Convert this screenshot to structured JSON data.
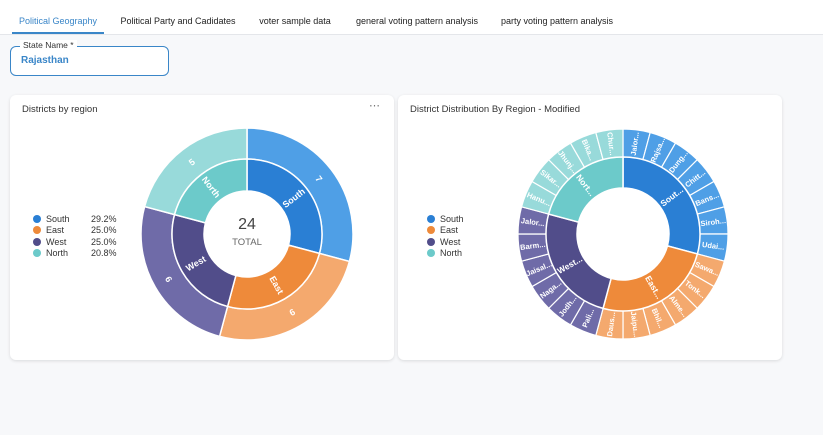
{
  "tabs": [
    {
      "label": "Political Geography",
      "active": true
    },
    {
      "label": "Political Party and Cadidates",
      "active": false
    },
    {
      "label": "voter sample data",
      "active": false
    },
    {
      "label": "general voting pattern analysis",
      "active": false
    },
    {
      "label": "party voting pattern analysis",
      "active": false
    }
  ],
  "state_field": {
    "label": "State Name *",
    "value": "Rajasthan"
  },
  "cards": [
    {
      "title": "Districts by region",
      "menu_icon": "more-horizontal-icon"
    },
    {
      "title": "District Distribution By Region - Modified"
    }
  ],
  "legend": [
    {
      "name": "South",
      "percent": "29.2%"
    },
    {
      "name": "East",
      "percent": "25.0%"
    },
    {
      "name": "West",
      "percent": "25.0%"
    },
    {
      "name": "North",
      "percent": "20.8%"
    }
  ],
  "colors": {
    "South": "#2a7fd4",
    "East": "#ee8a3a",
    "West": "#514d8a",
    "North": "#6ccaca",
    "South_outer": "#4f9fe6",
    "East_outer": "#f4a96e",
    "West_outer": "#6f6ba8",
    "North_outer": "#98dada",
    "accent": "#3a86c8"
  },
  "chart_data": [
    {
      "type": "pie",
      "title": "Districts by region",
      "center_value": "24",
      "center_label": "TOTAL",
      "inner": [
        {
          "name": "South",
          "value": 7
        },
        {
          "name": "East",
          "value": 6
        },
        {
          "name": "West",
          "value": 6
        },
        {
          "name": "North",
          "value": 5
        }
      ],
      "outer_labels": [
        "7",
        "6",
        "6",
        "5"
      ]
    },
    {
      "type": "pie",
      "title": "District Distribution By Region - Modified",
      "inner": [
        {
          "name": "South",
          "label": "Sout..."
        },
        {
          "name": "East",
          "label": "East..."
        },
        {
          "name": "West",
          "label": "West..."
        },
        {
          "name": "North",
          "label": "Nort..."
        }
      ],
      "outer": [
        {
          "region": "South",
          "label": "Jalor..."
        },
        {
          "region": "South",
          "label": "Rajsa..."
        },
        {
          "region": "South",
          "label": "Dung..."
        },
        {
          "region": "South",
          "label": "Chitt..."
        },
        {
          "region": "South",
          "label": "Bans..."
        },
        {
          "region": "South",
          "label": "Siroh..."
        },
        {
          "region": "South",
          "label": "Udai..."
        },
        {
          "region": "East",
          "label": "Sawa..."
        },
        {
          "region": "East",
          "label": "Tonk..."
        },
        {
          "region": "East",
          "label": "Alme..."
        },
        {
          "region": "East",
          "label": "Bhil..."
        },
        {
          "region": "East",
          "label": "Jaipu..."
        },
        {
          "region": "East",
          "label": "Daus..."
        },
        {
          "region": "West",
          "label": "Pali..."
        },
        {
          "region": "West",
          "label": "Jodh..."
        },
        {
          "region": "West",
          "label": "Naga..."
        },
        {
          "region": "West",
          "label": "Jaisal..."
        },
        {
          "region": "West",
          "label": "Barm..."
        },
        {
          "region": "West",
          "label": "Jalor..."
        },
        {
          "region": "North",
          "label": "Hanu..."
        },
        {
          "region": "North",
          "label": "Sikar..."
        },
        {
          "region": "North",
          "label": "Jhunj..."
        },
        {
          "region": "North",
          "label": "Bika..."
        },
        {
          "region": "North",
          "label": "Chur..."
        }
      ]
    }
  ]
}
